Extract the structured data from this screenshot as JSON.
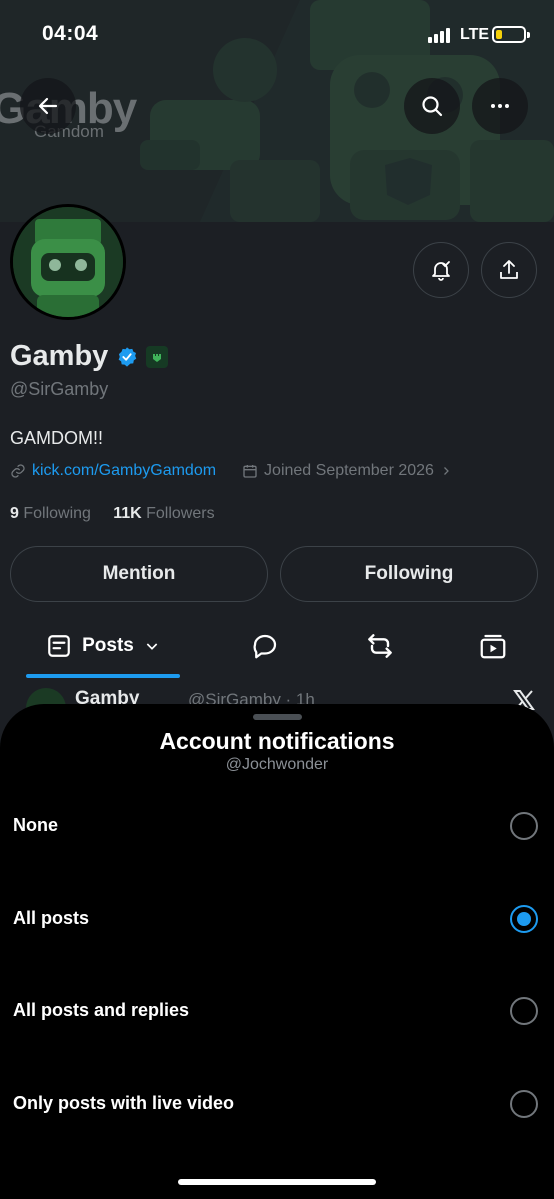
{
  "status_bar": {
    "time": "04:04",
    "network": "LTE"
  },
  "banner": {
    "brand_big": "Gamby",
    "brand_small": "Gamdom"
  },
  "profile": {
    "name": "Gamby",
    "handle": "@SirGamby",
    "bio": "GAMDOM!!",
    "link": "kick.com/GambyGamdom",
    "joined": "Joined September 2026",
    "following_count": "9",
    "following_label": "Following",
    "followers_count": "11K",
    "followers_label": "Followers",
    "mention_label": "Mention",
    "following_button_label": "Following"
  },
  "tabs": {
    "posts_label": "Posts"
  },
  "post_peek": {
    "name": "Gamby",
    "handle_time": "@SirGamby · 1h"
  },
  "sheet": {
    "title": "Account notifications",
    "subtitle": "@Jochwonder",
    "options": [
      {
        "label": "None",
        "selected": false
      },
      {
        "label": "All posts",
        "selected": true
      },
      {
        "label": "All posts and replies",
        "selected": false
      },
      {
        "label": "Only posts with live video",
        "selected": false
      }
    ]
  },
  "colors": {
    "accent": "#1d9bf0",
    "background": "#000000",
    "muted": "#71767b",
    "brand_green": "#2f7a3b"
  },
  "icons": [
    "back-arrow-icon",
    "search-icon",
    "more-icon",
    "bell-check-icon",
    "share-icon",
    "verified-icon",
    "affiliate-badge-icon",
    "link-icon",
    "calendar-icon",
    "posts-icon",
    "chevron-down-icon",
    "reply-icon",
    "repost-icon",
    "video-icon",
    "x-logo-icon"
  ]
}
